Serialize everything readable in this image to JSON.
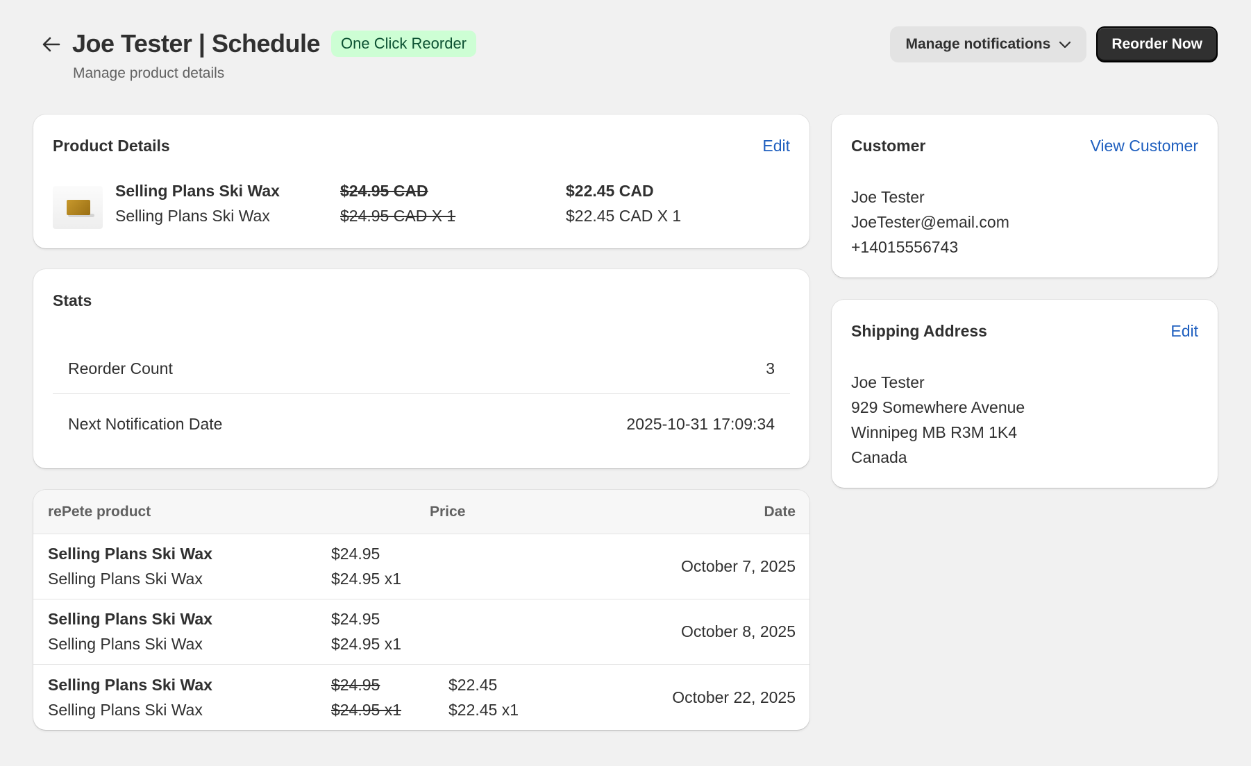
{
  "header": {
    "title": "Joe Tester | Schedule",
    "badge": "One Click Reorder",
    "subtitle": "Manage product details",
    "manage_notifications_label": "Manage notifications",
    "reorder_now_label": "Reorder Now"
  },
  "product_details": {
    "title": "Product Details",
    "edit_label": "Edit",
    "product_name": "Selling Plans Ski Wax",
    "variant_name": "Selling Plans Ski Wax",
    "original_price": "$24.95 CAD",
    "original_price_qty": "$24.95 CAD X 1",
    "discounted_price": "$22.45 CAD",
    "discounted_price_qty": "$22.45 CAD X 1"
  },
  "stats": {
    "title": "Stats",
    "rows": [
      {
        "label": "Reorder Count",
        "value": "3"
      },
      {
        "label": "Next Notification Date",
        "value": "2025-10-31 17:09:34"
      }
    ]
  },
  "orders_table": {
    "headers": {
      "product": "rePete product",
      "price": "Price",
      "date": "Date"
    },
    "rows": [
      {
        "product": "Selling Plans Ski Wax",
        "variant": "Selling Plans Ski Wax",
        "price": "$24.95",
        "price_qty": "$24.95 x1",
        "discount_price": "",
        "discount_price_qty": "",
        "date": "October 7, 2025"
      },
      {
        "product": "Selling Plans Ski Wax",
        "variant": "Selling Plans Ski Wax",
        "price": "$24.95",
        "price_qty": "$24.95 x1",
        "discount_price": "",
        "discount_price_qty": "",
        "date": "October 8, 2025"
      },
      {
        "product": "Selling Plans Ski Wax",
        "variant": "Selling Plans Ski Wax",
        "price": "$24.95",
        "price_qty": "$24.95 x1",
        "discount_price": "$22.45",
        "discount_price_qty": "$22.45 x1",
        "date": "October 22, 2025"
      }
    ]
  },
  "customer": {
    "title": "Customer",
    "view_label": "View Customer",
    "name": "Joe Tester",
    "email": "JoeTester@email.com",
    "phone": "+14015556743"
  },
  "shipping": {
    "title": "Shipping Address",
    "edit_label": "Edit",
    "name": "Joe Tester",
    "street": "929 Somewhere Avenue",
    "city": "Winnipeg MB R3M 1K4",
    "country": "Canada"
  },
  "icons": {
    "back": "arrow-left-icon",
    "dropdown": "chevron-down-icon",
    "product_image": "ski-wax-thumbnail"
  },
  "colors": {
    "background": "#f1f1f1",
    "link": "#1f5fbf",
    "badge_bg": "#cdfed4",
    "badge_text": "#0c5132",
    "primary_button": "#303030"
  }
}
